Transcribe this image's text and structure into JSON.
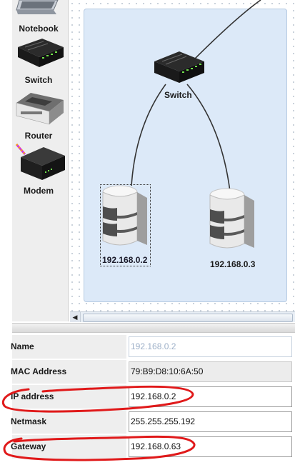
{
  "palette": {
    "items": [
      {
        "label": "Notebook",
        "icon": "notebook-icon"
      },
      {
        "label": "Switch",
        "icon": "switch-icon"
      },
      {
        "label": "Router",
        "icon": "router-icon"
      },
      {
        "label": "Modem",
        "icon": "modem-icon"
      }
    ]
  },
  "canvas": {
    "switch_label": "Switch",
    "server1_label": "192.168.0.2",
    "server2_label": "192.168.0.3"
  },
  "properties": {
    "rows": [
      {
        "label": "Name",
        "value": "192.168.0.2"
      },
      {
        "label": "MAC Address",
        "value": "79:B9:D8:10:6A:50"
      },
      {
        "label": "IP address",
        "value": "192.168.0.2"
      },
      {
        "label": "Netmask",
        "value": "255.255.255.192"
      },
      {
        "label": "Gateway",
        "value": "192.168.0.63"
      }
    ]
  },
  "colors": {
    "network_fill": "#dce9f8",
    "annotation": "#e0191a"
  }
}
